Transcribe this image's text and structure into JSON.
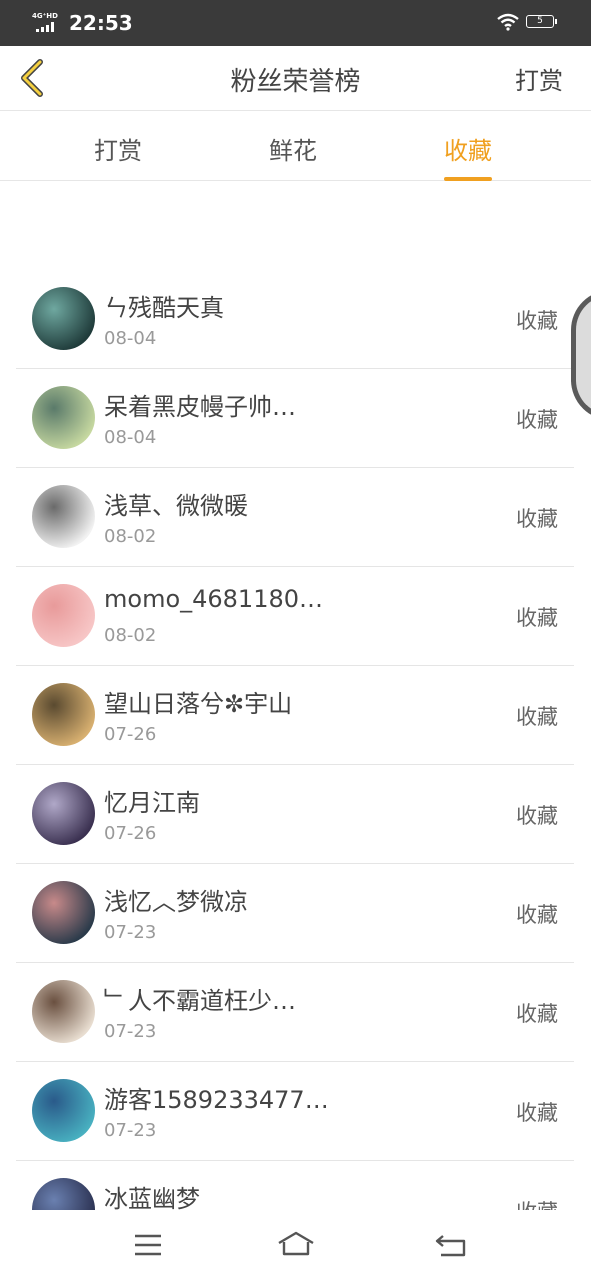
{
  "status": {
    "network": "4G⁺HD",
    "time": "22:53",
    "battery": "5"
  },
  "header": {
    "title": "粉丝荣誉榜",
    "action": "打赏"
  },
  "tabs": [
    {
      "label": "打赏"
    },
    {
      "label": "鲜花"
    },
    {
      "label": "收藏"
    }
  ],
  "active_tab": "收藏",
  "list": [
    {
      "name": "ㄣ残酷天真",
      "date": "08-04",
      "tag": "收藏",
      "colors": [
        "#1f3b3a",
        "#6fa8a0"
      ]
    },
    {
      "name": "呆着黑皮幔子帅…",
      "date": "08-04",
      "tag": "收藏",
      "colors": [
        "#c6d8a0",
        "#5a7a6a"
      ]
    },
    {
      "name": "浅草、微微暖",
      "date": "08-02",
      "tag": "收藏",
      "colors": [
        "#f2f2f2",
        "#6a6a6a"
      ]
    },
    {
      "name": "momo_4681180…",
      "date": "08-02",
      "tag": "收藏",
      "colors": [
        "#f7c6c6",
        "#e89a9a"
      ]
    },
    {
      "name": "望山日落兮✼宇山",
      "date": "07-26",
      "tag": "收藏",
      "colors": [
        "#d8b070",
        "#5a4a30"
      ]
    },
    {
      "name": "忆月江南",
      "date": "07-26",
      "tag": "收藏",
      "colors": [
        "#3a3050",
        "#b0a8c8"
      ]
    },
    {
      "name": "浅忆︿梦微凉",
      "date": "07-23",
      "tag": "收藏",
      "colors": [
        "#2a3a4a",
        "#c88a8a"
      ]
    },
    {
      "name": "﹂人不霸道枉少…",
      "date": "07-23",
      "tag": "收藏",
      "colors": [
        "#e8ddd0",
        "#6a5040"
      ]
    },
    {
      "name": "游客1589233477…",
      "date": "07-23",
      "tag": "收藏",
      "colors": [
        "#48b0c0",
        "#2a5a8a"
      ]
    },
    {
      "name": "冰蓝幽梦",
      "date": "",
      "tag": "收藏",
      "colors": [
        "#2a3050",
        "#6a80b0"
      ]
    }
  ],
  "icons": {
    "back": "chevron-left-icon",
    "menu": "menu-icon",
    "home": "home-icon",
    "back_nav": "return-icon"
  },
  "colors": {
    "accent": "#f0a020",
    "status_bar": "#3a3a3a"
  }
}
